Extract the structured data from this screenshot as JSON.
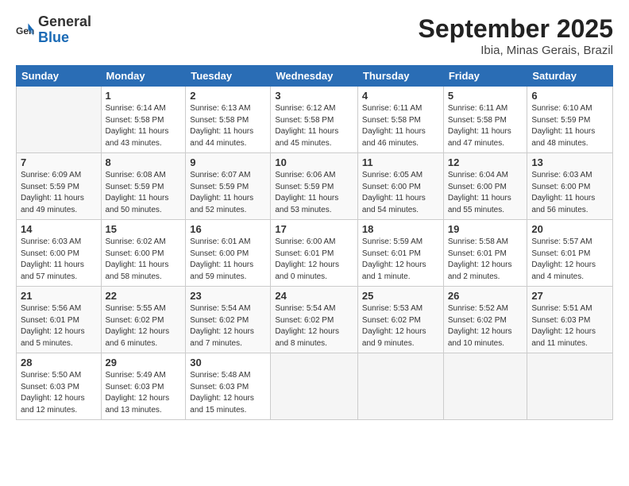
{
  "logo": {
    "general": "General",
    "blue": "Blue"
  },
  "title": "September 2025",
  "location": "Ibia, Minas Gerais, Brazil",
  "weekdays": [
    "Sunday",
    "Monday",
    "Tuesday",
    "Wednesday",
    "Thursday",
    "Friday",
    "Saturday"
  ],
  "weeks": [
    [
      {
        "day": "",
        "info": ""
      },
      {
        "day": "1",
        "info": "Sunrise: 6:14 AM\nSunset: 5:58 PM\nDaylight: 11 hours\nand 43 minutes."
      },
      {
        "day": "2",
        "info": "Sunrise: 6:13 AM\nSunset: 5:58 PM\nDaylight: 11 hours\nand 44 minutes."
      },
      {
        "day": "3",
        "info": "Sunrise: 6:12 AM\nSunset: 5:58 PM\nDaylight: 11 hours\nand 45 minutes."
      },
      {
        "day": "4",
        "info": "Sunrise: 6:11 AM\nSunset: 5:58 PM\nDaylight: 11 hours\nand 46 minutes."
      },
      {
        "day": "5",
        "info": "Sunrise: 6:11 AM\nSunset: 5:58 PM\nDaylight: 11 hours\nand 47 minutes."
      },
      {
        "day": "6",
        "info": "Sunrise: 6:10 AM\nSunset: 5:59 PM\nDaylight: 11 hours\nand 48 minutes."
      }
    ],
    [
      {
        "day": "7",
        "info": "Sunrise: 6:09 AM\nSunset: 5:59 PM\nDaylight: 11 hours\nand 49 minutes."
      },
      {
        "day": "8",
        "info": "Sunrise: 6:08 AM\nSunset: 5:59 PM\nDaylight: 11 hours\nand 50 minutes."
      },
      {
        "day": "9",
        "info": "Sunrise: 6:07 AM\nSunset: 5:59 PM\nDaylight: 11 hours\nand 52 minutes."
      },
      {
        "day": "10",
        "info": "Sunrise: 6:06 AM\nSunset: 5:59 PM\nDaylight: 11 hours\nand 53 minutes."
      },
      {
        "day": "11",
        "info": "Sunrise: 6:05 AM\nSunset: 6:00 PM\nDaylight: 11 hours\nand 54 minutes."
      },
      {
        "day": "12",
        "info": "Sunrise: 6:04 AM\nSunset: 6:00 PM\nDaylight: 11 hours\nand 55 minutes."
      },
      {
        "day": "13",
        "info": "Sunrise: 6:03 AM\nSunset: 6:00 PM\nDaylight: 11 hours\nand 56 minutes."
      }
    ],
    [
      {
        "day": "14",
        "info": "Sunrise: 6:03 AM\nSunset: 6:00 PM\nDaylight: 11 hours\nand 57 minutes."
      },
      {
        "day": "15",
        "info": "Sunrise: 6:02 AM\nSunset: 6:00 PM\nDaylight: 11 hours\nand 58 minutes."
      },
      {
        "day": "16",
        "info": "Sunrise: 6:01 AM\nSunset: 6:00 PM\nDaylight: 11 hours\nand 59 minutes."
      },
      {
        "day": "17",
        "info": "Sunrise: 6:00 AM\nSunset: 6:01 PM\nDaylight: 12 hours\nand 0 minutes."
      },
      {
        "day": "18",
        "info": "Sunrise: 5:59 AM\nSunset: 6:01 PM\nDaylight: 12 hours\nand 1 minute."
      },
      {
        "day": "19",
        "info": "Sunrise: 5:58 AM\nSunset: 6:01 PM\nDaylight: 12 hours\nand 2 minutes."
      },
      {
        "day": "20",
        "info": "Sunrise: 5:57 AM\nSunset: 6:01 PM\nDaylight: 12 hours\nand 4 minutes."
      }
    ],
    [
      {
        "day": "21",
        "info": "Sunrise: 5:56 AM\nSunset: 6:01 PM\nDaylight: 12 hours\nand 5 minutes."
      },
      {
        "day": "22",
        "info": "Sunrise: 5:55 AM\nSunset: 6:02 PM\nDaylight: 12 hours\nand 6 minutes."
      },
      {
        "day": "23",
        "info": "Sunrise: 5:54 AM\nSunset: 6:02 PM\nDaylight: 12 hours\nand 7 minutes."
      },
      {
        "day": "24",
        "info": "Sunrise: 5:54 AM\nSunset: 6:02 PM\nDaylight: 12 hours\nand 8 minutes."
      },
      {
        "day": "25",
        "info": "Sunrise: 5:53 AM\nSunset: 6:02 PM\nDaylight: 12 hours\nand 9 minutes."
      },
      {
        "day": "26",
        "info": "Sunrise: 5:52 AM\nSunset: 6:02 PM\nDaylight: 12 hours\nand 10 minutes."
      },
      {
        "day": "27",
        "info": "Sunrise: 5:51 AM\nSunset: 6:03 PM\nDaylight: 12 hours\nand 11 minutes."
      }
    ],
    [
      {
        "day": "28",
        "info": "Sunrise: 5:50 AM\nSunset: 6:03 PM\nDaylight: 12 hours\nand 12 minutes."
      },
      {
        "day": "29",
        "info": "Sunrise: 5:49 AM\nSunset: 6:03 PM\nDaylight: 12 hours\nand 13 minutes."
      },
      {
        "day": "30",
        "info": "Sunrise: 5:48 AM\nSunset: 6:03 PM\nDaylight: 12 hours\nand 15 minutes."
      },
      {
        "day": "",
        "info": ""
      },
      {
        "day": "",
        "info": ""
      },
      {
        "day": "",
        "info": ""
      },
      {
        "day": "",
        "info": ""
      }
    ]
  ]
}
